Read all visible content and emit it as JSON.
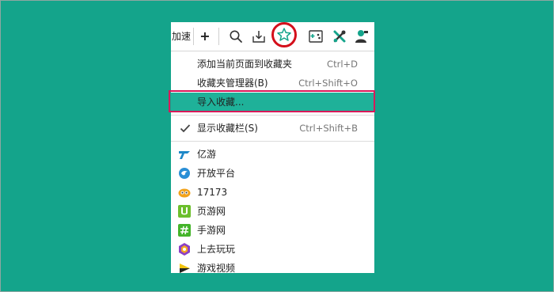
{
  "toolbar": {
    "tab_partial_text": "加速",
    "new_tab_label": "+"
  },
  "menu": {
    "top_items": [
      {
        "label": "添加当前页面到收藏夹",
        "shortcut": "Ctrl+D"
      },
      {
        "label": "收藏夹管理器(B)",
        "shortcut": "Ctrl+Shift+O"
      },
      {
        "label": "导入收藏...",
        "shortcut": ""
      }
    ],
    "show_bar": {
      "label": "显示收藏栏(S)",
      "shortcut": "Ctrl+Shift+B",
      "checked": true
    },
    "bookmarks": [
      {
        "label": "亿游",
        "icon": "yiyou-icon"
      },
      {
        "label": "开放平台",
        "icon": "open-platform-icon"
      },
      {
        "label": "17173",
        "icon": "17173-icon"
      },
      {
        "label": "页游网",
        "icon": "yeyou-icon"
      },
      {
        "label": "手游网",
        "icon": "shouyou-icon"
      },
      {
        "label": "上去玩玩",
        "icon": "shangqu-icon"
      },
      {
        "label": "游戏视频",
        "icon": "game-video-icon"
      }
    ]
  },
  "colors": {
    "background": "#14a48b",
    "highlight_row": "#1fb199",
    "ring": "#d40f1b",
    "box": "#d8195a"
  }
}
